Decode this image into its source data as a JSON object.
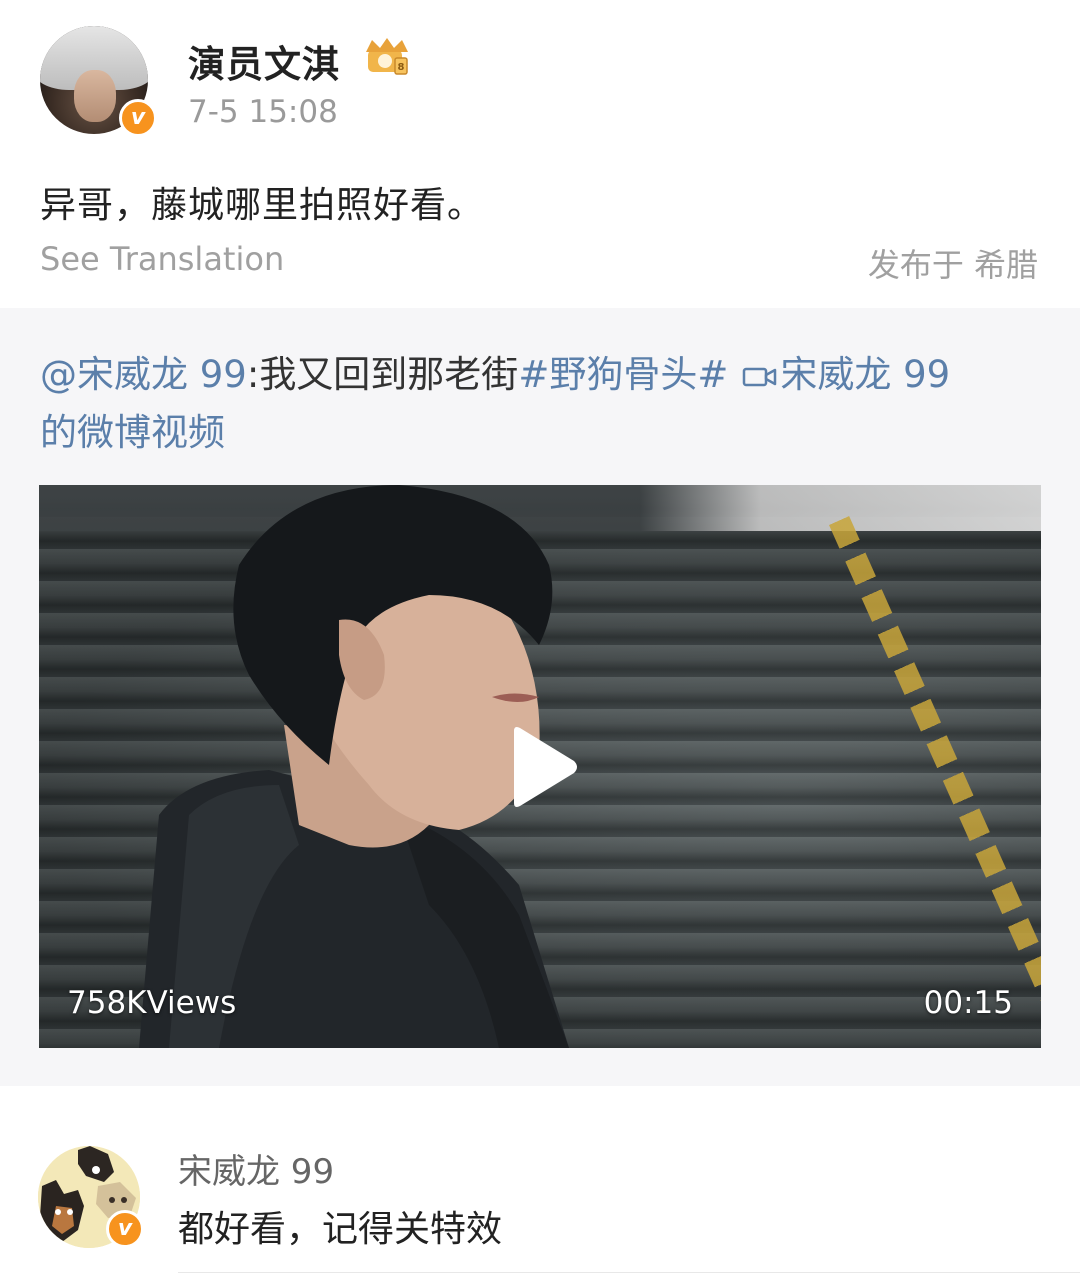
{
  "post": {
    "author": "演员文淇",
    "timestamp": "7-5 15:08",
    "text": "异哥，藤城哪里拍照好看。",
    "see_translation": "See Translation",
    "location": "发布于 希腊"
  },
  "repost": {
    "mention": "@宋威龙 99",
    "separator": ":",
    "body": "我又回到那老街",
    "hashtag": "#野狗骨头#",
    "video_source": "宋威龙 99",
    "video_suffix": "的微博视频",
    "video": {
      "views": "758KViews",
      "duration": "00:15"
    }
  },
  "comment": {
    "author": "宋威龙 99",
    "text": "都好看，记得关特效"
  },
  "colors": {
    "link": "#5b7faa",
    "verified_badge": "#f7931e",
    "muted_text": "#9a9a9a",
    "repost_background": "#f6f6f8"
  },
  "icons": {
    "verified": "verified-v-icon",
    "crown": "crown-level-icon",
    "video_link": "video-camera-icon",
    "play": "play-icon"
  }
}
